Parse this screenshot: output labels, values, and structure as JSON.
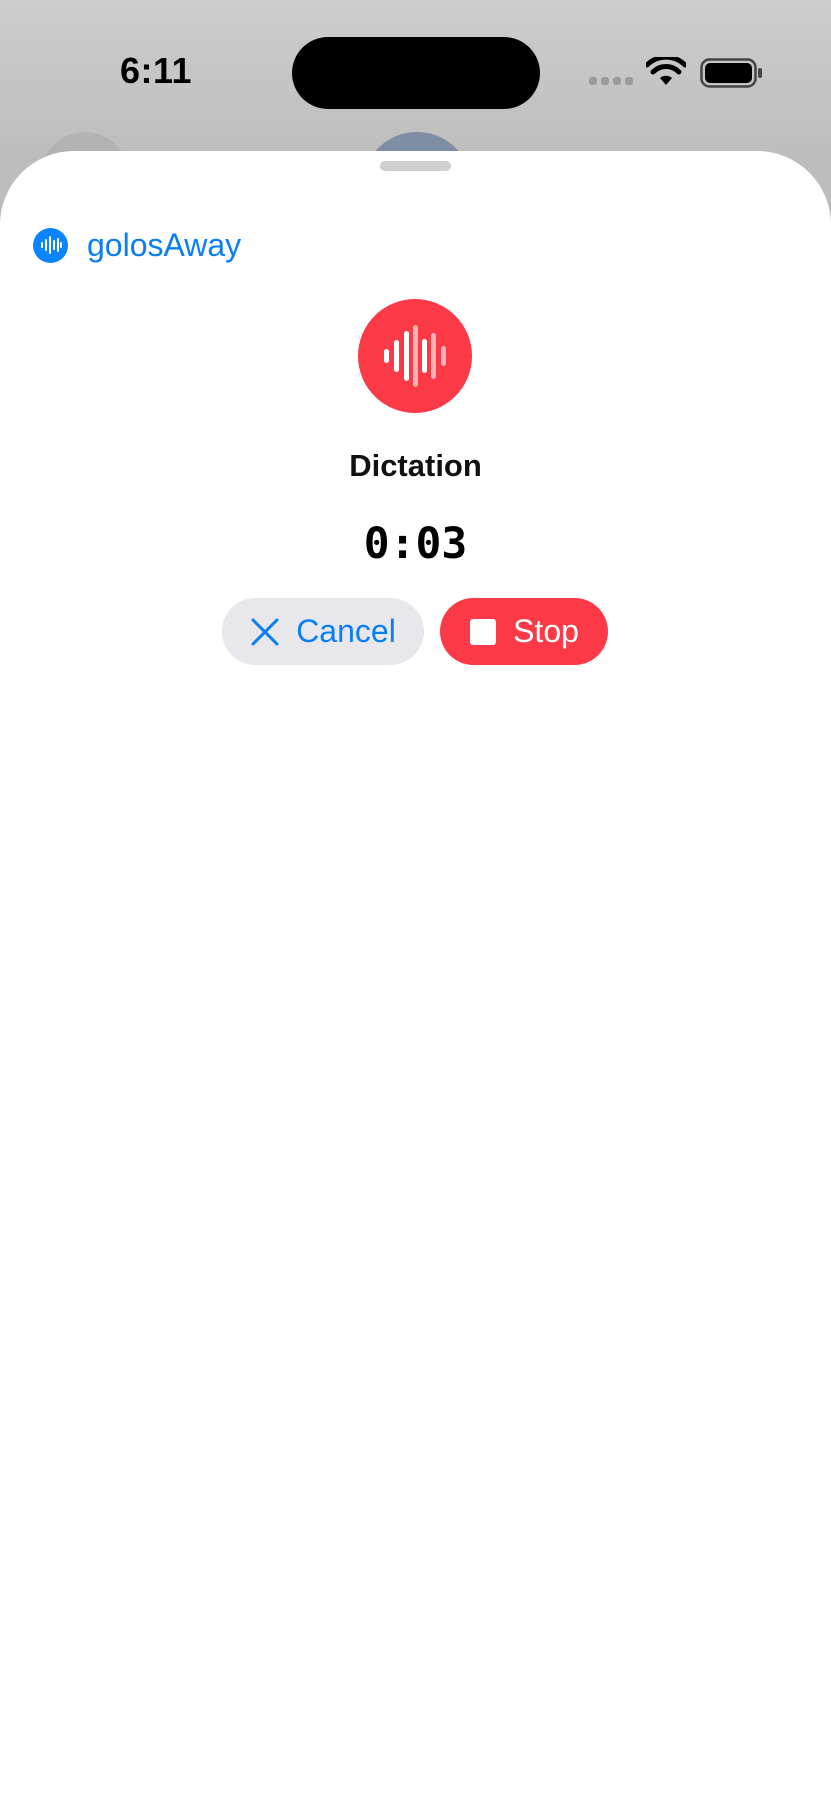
{
  "status_bar": {
    "time": "6:11",
    "icons": [
      "cellular-signal-icon",
      "wifi-icon",
      "battery-icon"
    ]
  },
  "sheet": {
    "app_name": "golosAway",
    "app_icon": "waveform-icon",
    "record_icon": "waveform-icon",
    "title": "Dictation",
    "timer": "0:03",
    "buttons": {
      "cancel_label": "Cancel",
      "cancel_icon": "close-icon",
      "stop_label": "Stop",
      "stop_icon": "stop-icon"
    }
  },
  "colors": {
    "accent_blue": "#0a7ff5",
    "record_red": "#fc3a47",
    "cancel_bg": "#e8e8ec",
    "sheet_bg": "#ffffff"
  }
}
